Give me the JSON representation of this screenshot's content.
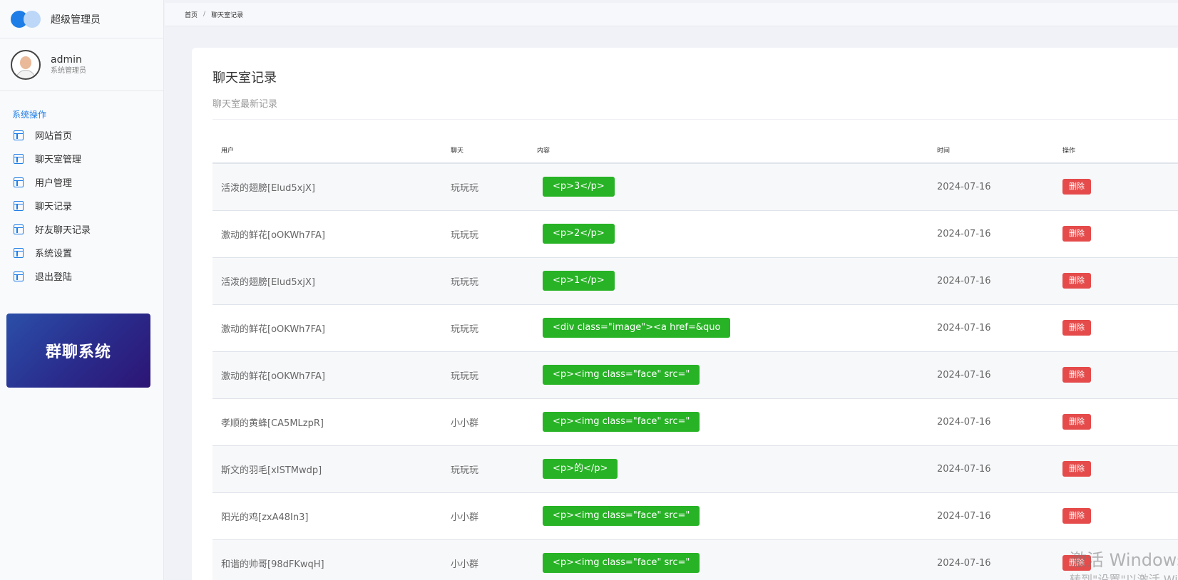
{
  "sidebar": {
    "brand_title": "超级管理员",
    "user": {
      "name": "admin",
      "role": "系统管理员"
    },
    "section_title": "系统操作",
    "items": [
      {
        "label": "网站首页"
      },
      {
        "label": "聊天室管理"
      },
      {
        "label": "用户管理"
      },
      {
        "label": "聊天记录"
      },
      {
        "label": "好友聊天记录"
      },
      {
        "label": "系统设置"
      },
      {
        "label": "退出登陆"
      }
    ],
    "promo_text": "群聊系统"
  },
  "breadcrumb": {
    "home": "首页",
    "sep": "/",
    "current": "聊天室记录"
  },
  "card": {
    "title": "聊天室记录",
    "subtitle": "聊天室最新记录"
  },
  "table": {
    "headers": {
      "user": "用户",
      "chat": "聊天",
      "content": "内容",
      "time": "时间",
      "action": "操作"
    },
    "delete_label": "删除",
    "rows": [
      {
        "user": "活泼的翅膀[Elud5xjX]",
        "chat": "玩玩玩",
        "content": "<p>3</p>",
        "time": "2024-07-16"
      },
      {
        "user": "激动的鲜花[oOKWh7FA]",
        "chat": "玩玩玩",
        "content": "<p>2</p>",
        "time": "2024-07-16"
      },
      {
        "user": "活泼的翅膀[Elud5xjX]",
        "chat": "玩玩玩",
        "content": "<p>1</p>",
        "time": "2024-07-16"
      },
      {
        "user": "激动的鲜花[oOKWh7FA]",
        "chat": "玩玩玩",
        "content": "<div class=\"image\"><a href=&quo",
        "time": "2024-07-16"
      },
      {
        "user": "激动的鲜花[oOKWh7FA]",
        "chat": "玩玩玩",
        "content": "<p><img class=\"face\" src=\"",
        "time": "2024-07-16"
      },
      {
        "user": "孝顺的黄蜂[CA5MLzpR]",
        "chat": "小小群",
        "content": "<p><img class=\"face\" src=\"",
        "time": "2024-07-16"
      },
      {
        "user": "斯文的羽毛[xISTMwdp]",
        "chat": "玩玩玩",
        "content": "<p>的</p>",
        "time": "2024-07-16"
      },
      {
        "user": "阳光的鸡[zxA48In3]",
        "chat": "小小群",
        "content": "<p><img class=\"face\" src=\"",
        "time": "2024-07-16"
      },
      {
        "user": "和谐的帅哥[98dFKwqH]",
        "chat": "小小群",
        "content": "<p><img class=\"face\" src=\"",
        "time": "2024-07-16"
      }
    ]
  },
  "watermark": {
    "line1": "激活 Windows",
    "line2": "转到\"设置\"以激活 Windows。"
  }
}
